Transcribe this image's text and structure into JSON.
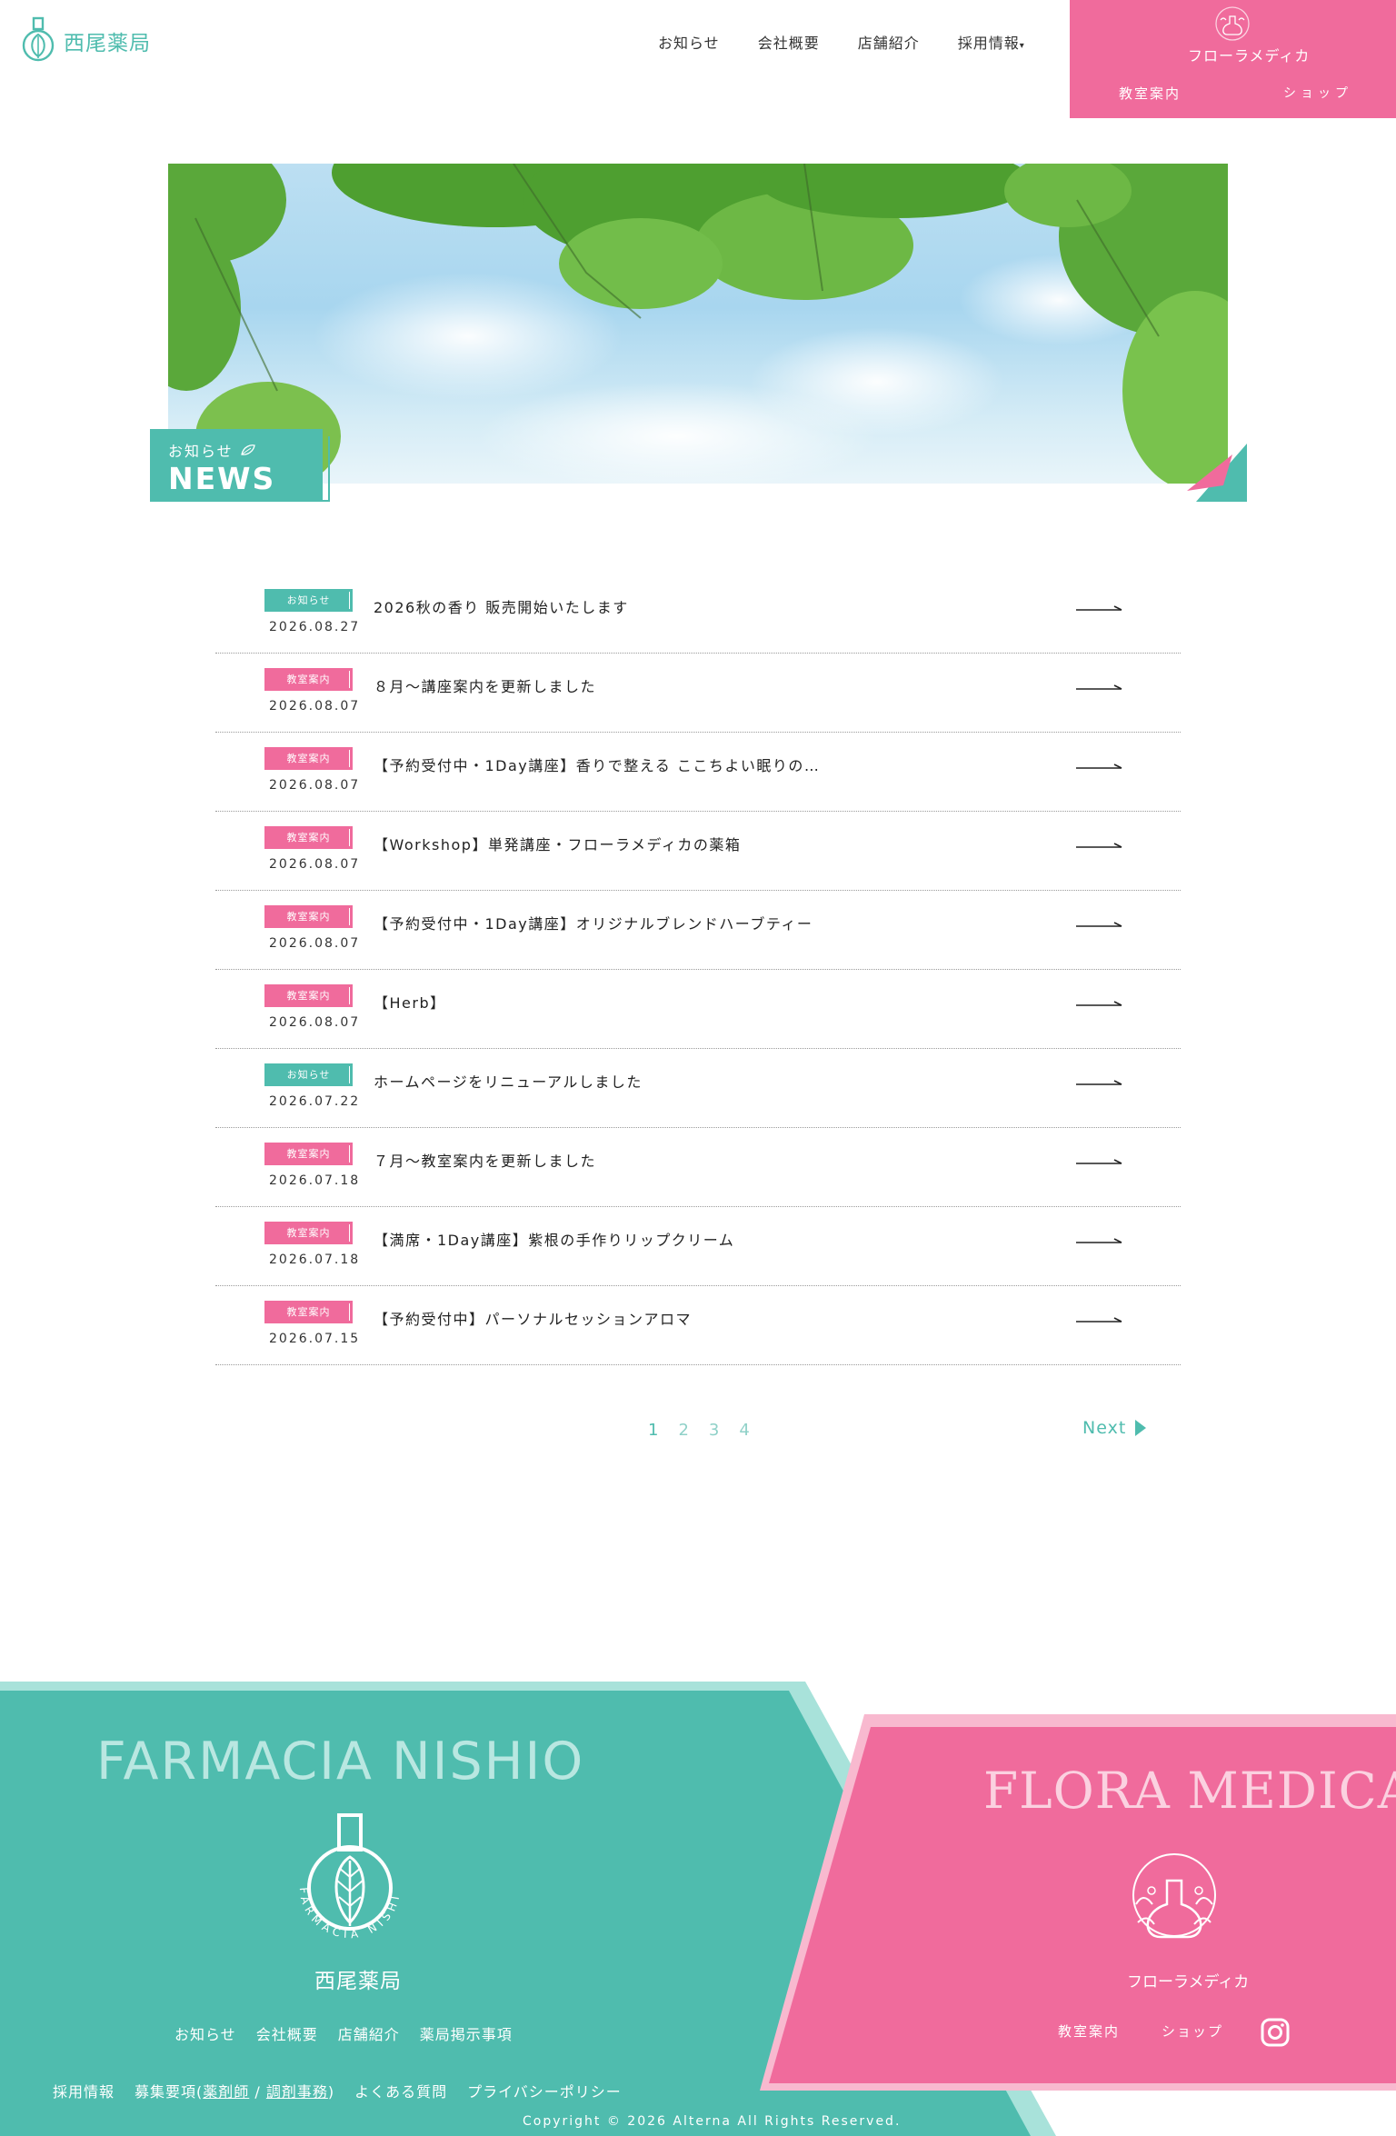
{
  "header": {
    "logo_text": "西尾薬局",
    "nav": [
      "お知らせ",
      "会社概要",
      "店舗紹介",
      "採用情報"
    ],
    "nav_caret": "▾",
    "flora": {
      "brand": "フローラメディカ",
      "links": [
        "教室案内",
        "ショップ"
      ]
    }
  },
  "hero": {
    "label_jp": "お知らせ",
    "label_en": "NEWS"
  },
  "news": [
    {
      "category": "お知らせ",
      "type": "t",
      "date": "2026.08.27",
      "title": "2026秋の香り 販売開始いたします"
    },
    {
      "category": "教室案内",
      "type": "p",
      "date": "2026.08.07",
      "title": "８月～講座案内を更新しました"
    },
    {
      "category": "教室案内",
      "type": "p",
      "date": "2026.08.07",
      "title": "【予約受付中・1Day講座】香りで整える ここちよい眠りの…"
    },
    {
      "category": "教室案内",
      "type": "p",
      "date": "2026.08.07",
      "title": "【Workshop】単発講座・フローラメディカの薬箱"
    },
    {
      "category": "教室案内",
      "type": "p",
      "date": "2026.08.07",
      "title": "【予約受付中・1Day講座】オリジナルブレンドハーブティー"
    },
    {
      "category": "教室案内",
      "type": "p",
      "date": "2026.08.07",
      "title": "【Herb】"
    },
    {
      "category": "お知らせ",
      "type": "t",
      "date": "2026.07.22",
      "title": "ホームページをリニューアルしました"
    },
    {
      "category": "教室案内",
      "type": "p",
      "date": "2026.07.18",
      "title": "７月～教室案内を更新しました"
    },
    {
      "category": "教室案内",
      "type": "p",
      "date": "2026.07.18",
      "title": "【満席・1Day講座】紫根の手作りリップクリーム"
    },
    {
      "category": "教室案内",
      "type": "p",
      "date": "2026.07.15",
      "title": "【予約受付中】パーソナルセッションアロマ"
    }
  ],
  "pagination": {
    "pages": [
      "1",
      "2",
      "3",
      "4"
    ],
    "current": "1",
    "next": "Next"
  },
  "footer": {
    "farm_title": "FARMACIA NISHIO",
    "farm_logo_ring": "FARMACIA NISHIO",
    "farm_logo_text": "西尾薬局",
    "farm_nav": [
      "お知らせ",
      "会社概要",
      "店舗紹介",
      "薬局掲示事項"
    ],
    "farm_nav2_a": "採用情報",
    "farm_nav2_b_prefix": "募集要項(",
    "farm_nav2_b_link1": "薬剤師",
    "farm_nav2_b_sep": " / ",
    "farm_nav2_b_link2": "調剤事務",
    "farm_nav2_b_suffix": ")",
    "farm_nav2_c": "よくある質問",
    "farm_nav2_d": "プライバシーポリシー",
    "copyright": "Copyright © 2026 Alterna All Rights Reserved.",
    "flora_title": "FLORA MEDICA",
    "flora_logo_text": "フローラメディカ",
    "flora_nav": [
      "教室案内",
      "ショップ"
    ],
    "instagram_icon": "instagram-icon"
  },
  "colors": {
    "teal": "#4fbcae",
    "pink": "#f06b9c",
    "teal_light": "#a8e2da",
    "pink_light": "#f8b9cf"
  }
}
